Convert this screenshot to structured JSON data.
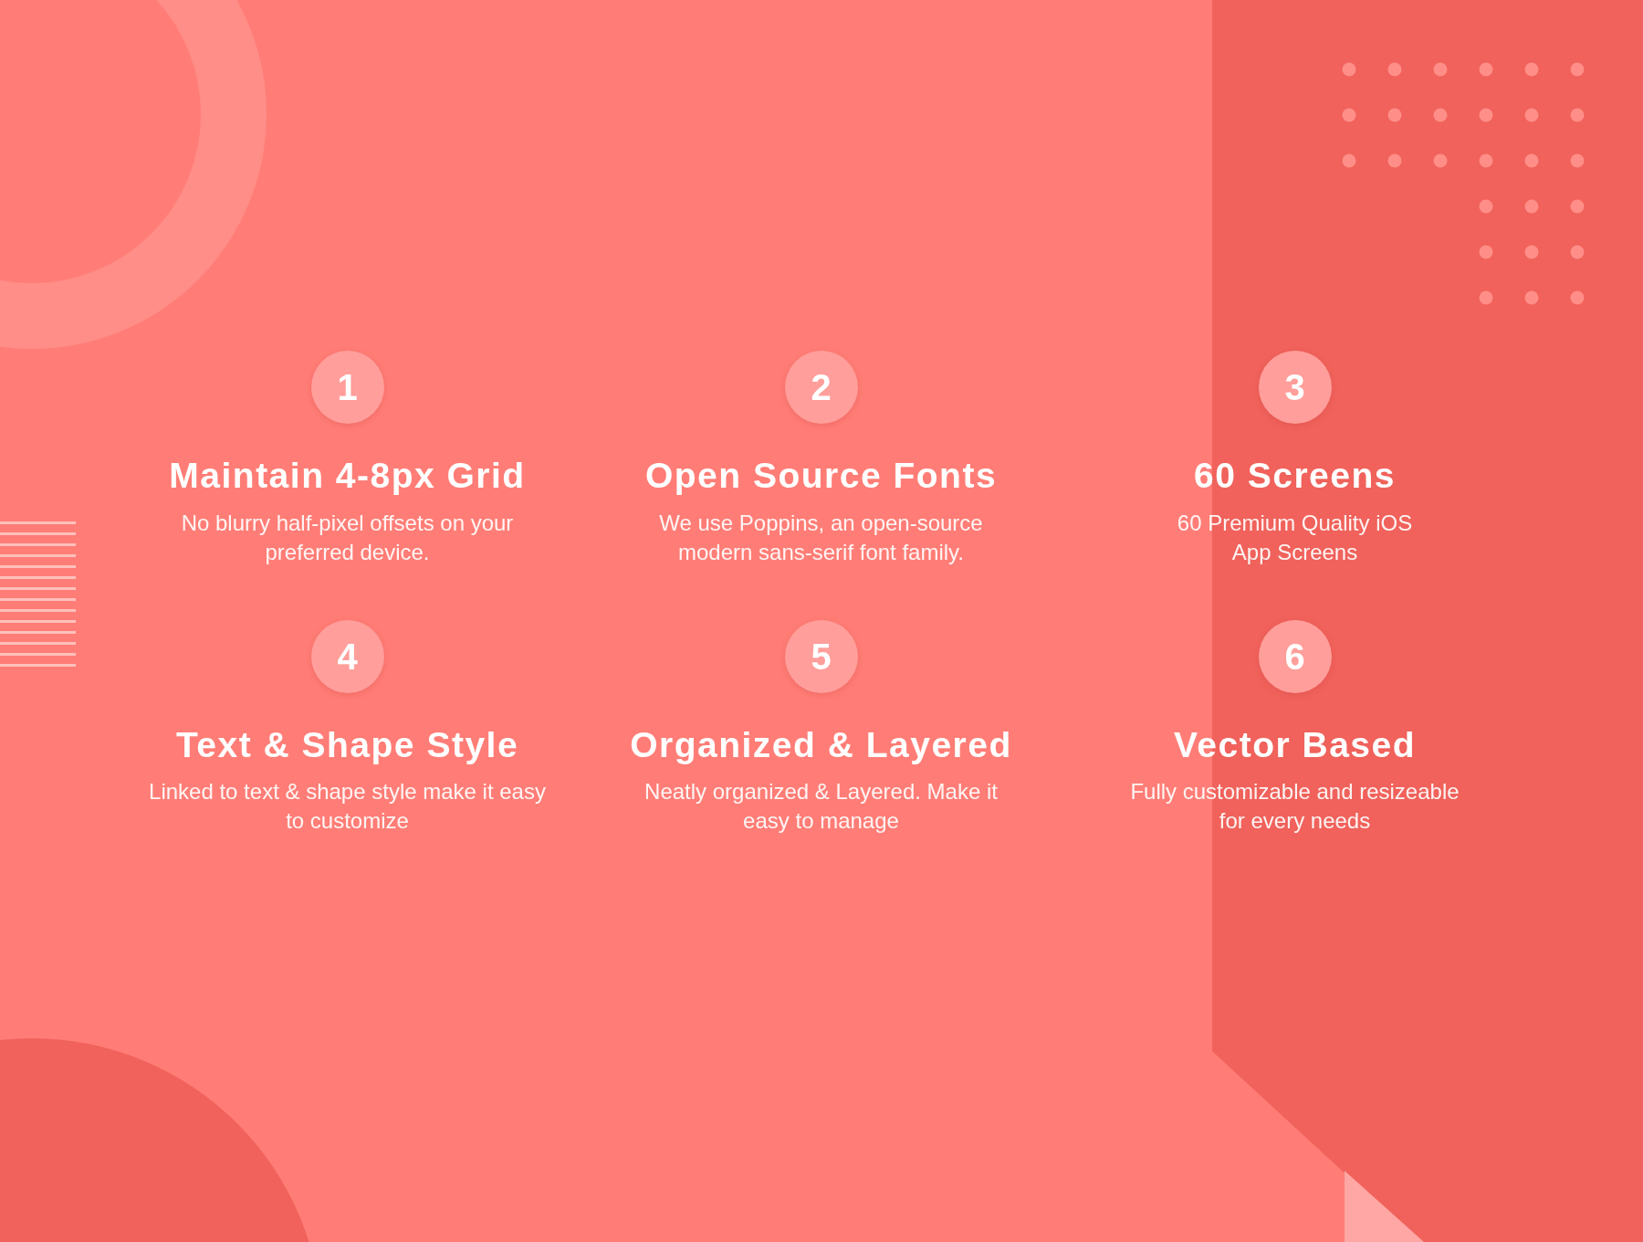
{
  "features": [
    {
      "number": "1",
      "title": "Maintain 4-8px Grid",
      "description": "No blurry half-pixel offsets on your\npreferred device."
    },
    {
      "number": "2",
      "title": "Open Source Fonts",
      "description": "We use Poppins, an open-source\nmodern sans-serif font family."
    },
    {
      "number": "3",
      "title": "60 Screens",
      "description": "60 Premium Quality iOS\nApp Screens"
    },
    {
      "number": "4",
      "title": "Text & Shape Style",
      "description": "Linked to text & shape style make it easy\nto customize"
    },
    {
      "number": "5",
      "title": "Organized & Layered",
      "description": "Neatly organized & Layered. Make it\neasy to manage"
    },
    {
      "number": "6",
      "title": "Vector Based",
      "description": "Fully customizable and resizeable\nfor every needs"
    }
  ]
}
